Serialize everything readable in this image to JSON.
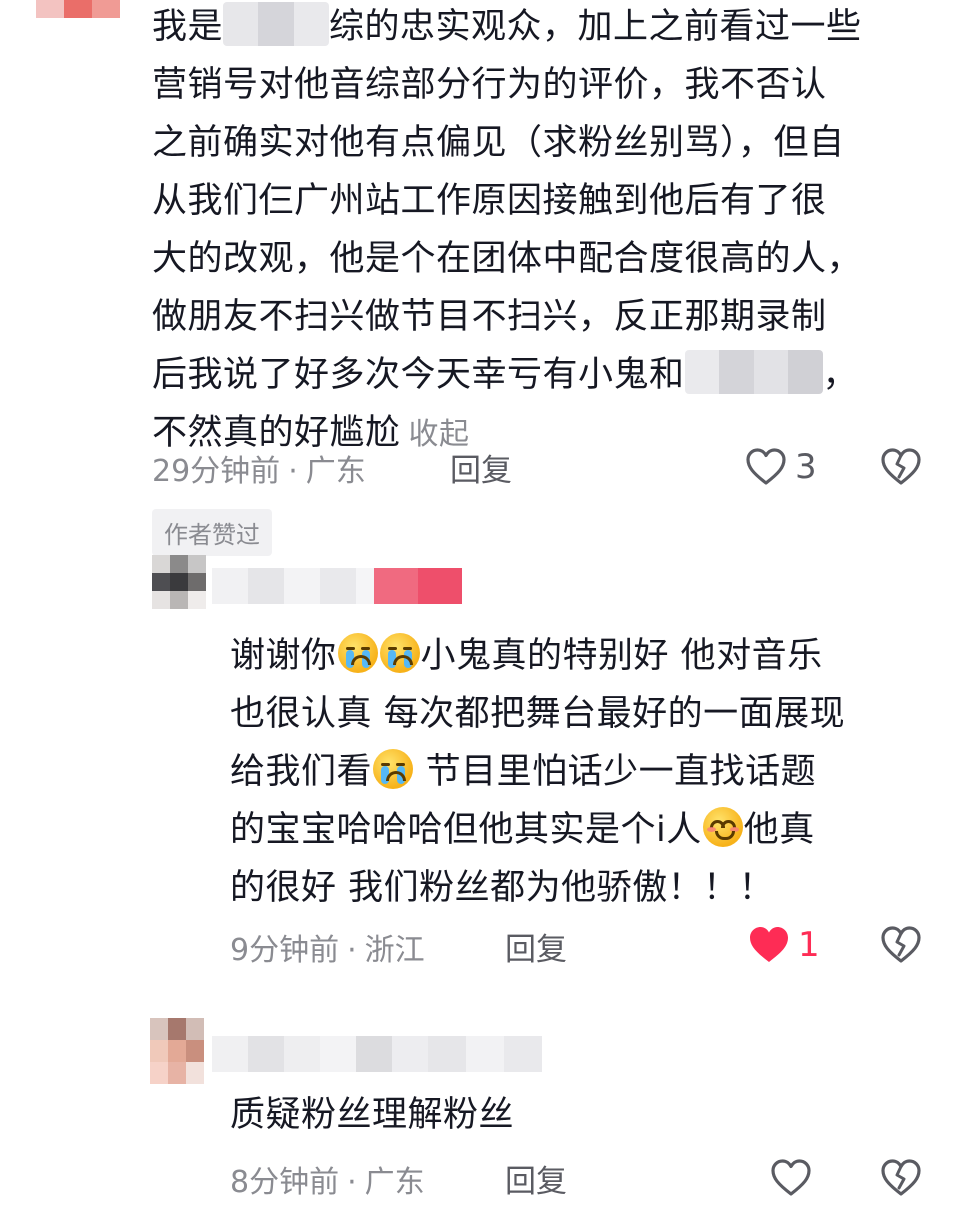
{
  "comments": [
    {
      "text_lines": [
        "我是",
        "综的忠实观众，加上之前看过一些",
        "营销号对他音综部分行为的评价，我不否认",
        "之前确实对他有点偏见（求粉丝别骂），但自",
        "从我们仨广州站工作原因接触到他后有了很",
        "大的改观，他是个在团体中配合度很高的人，",
        "做朋友不扫兴做节目不扫兴，反正那期录制",
        "后我说了好多次今天幸亏有小鬼和",
        "，",
        "不然真的好尴尬"
      ],
      "collapse_label": "收起",
      "time": "29分钟前",
      "location": "广东",
      "reply_label": "回复",
      "like_count": "3",
      "author_liked_label": "作者赞过"
    },
    {
      "text_lines": [
        "谢谢你",
        "小鬼真的特别好 他对音乐",
        "也很认真 每次都把舞台最好的一面展现",
        "给我们看",
        " 节目里怕话少一直找话题",
        "的宝宝哈哈哈但他其实是个i人",
        "他真",
        "的很好 我们粉丝都为他骄傲！！！"
      ],
      "time": "9分钟前",
      "location": "浙江",
      "reply_label": "回复",
      "like_count": "1",
      "liked": true
    },
    {
      "text": "质疑粉丝理解粉丝",
      "time": "8分钟前",
      "location": "广东",
      "reply_label": "回复"
    }
  ],
  "meta_separator": "·",
  "icons": {
    "like": "heart-outline-icon",
    "liked": "heart-filled-icon",
    "dislike": "broken-heart-icon"
  },
  "colors": {
    "text": "#161823",
    "meta": "#8a8b91",
    "liked_red": "#fe2c55"
  }
}
